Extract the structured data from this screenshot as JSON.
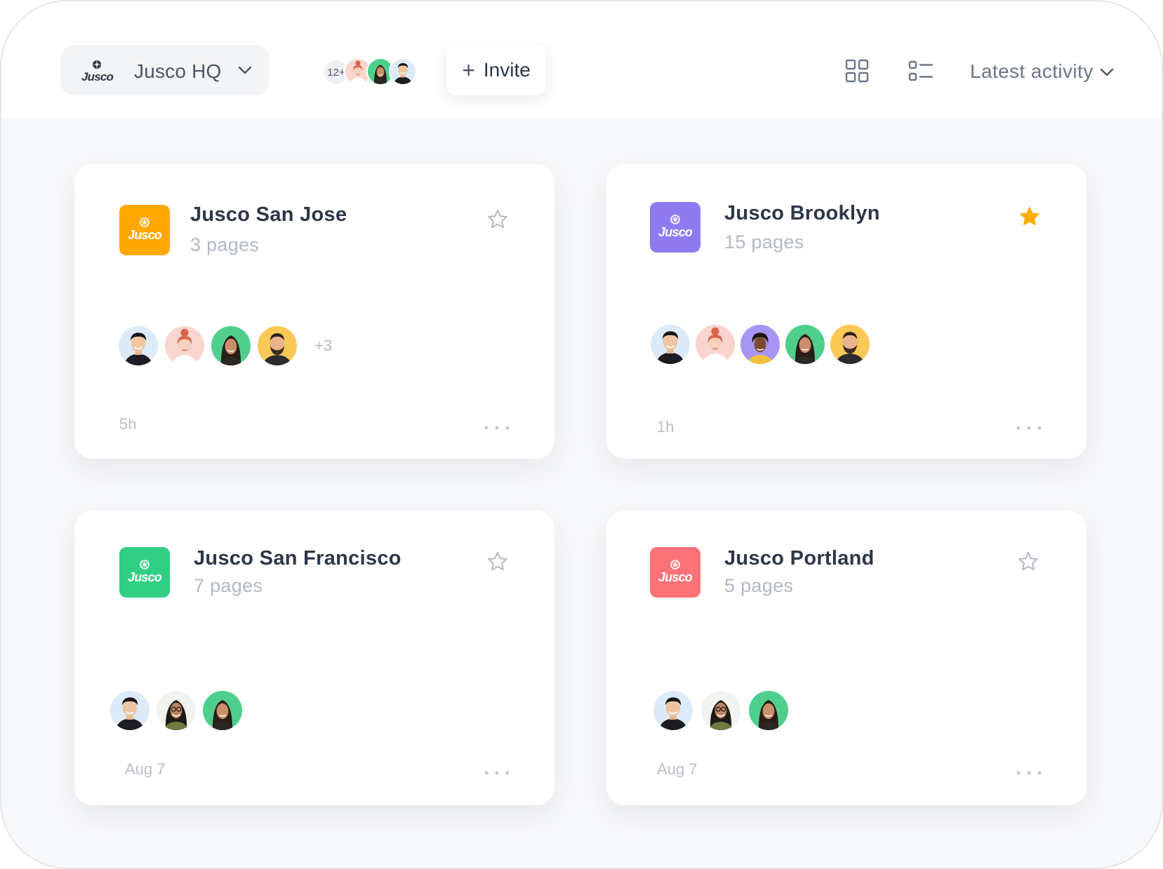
{
  "workspace": {
    "label": "Jusco HQ",
    "logo_text": "Jusco"
  },
  "members": {
    "count_label": "12+"
  },
  "invite": {
    "label": "Invite"
  },
  "sort": {
    "label": "Latest activity"
  },
  "icons": {
    "workspace_chevron": "chevron-down-icon",
    "grid_view": "grid-view-icon",
    "list_view": "list-view-icon",
    "star": "star-icon",
    "more": "more-horizontal-icon"
  },
  "colors": {
    "orange": "#ffa800",
    "purple": "#8f7af2",
    "green": "#31cf84",
    "red": "#fb7277",
    "star_active": "#ffad00",
    "star_inactive": "#b5bcc7"
  },
  "cards": [
    {
      "title": "Jusco San Jose",
      "subtitle": "3 pages",
      "logo_text": "Jusco",
      "extra": "+3",
      "time": "5h",
      "starred": false
    },
    {
      "title": "Jusco Brooklyn",
      "subtitle": "15 pages",
      "logo_text": "Jusco",
      "time": "1h",
      "starred": true
    },
    {
      "title": "Jusco San Francisco",
      "subtitle": "7 pages",
      "logo_text": "Jusco",
      "time": "Aug 7",
      "starred": false
    },
    {
      "title": "Jusco Portland",
      "subtitle": "5 pages",
      "logo_text": "Jusco",
      "time": "Aug 7",
      "starred": false
    }
  ]
}
